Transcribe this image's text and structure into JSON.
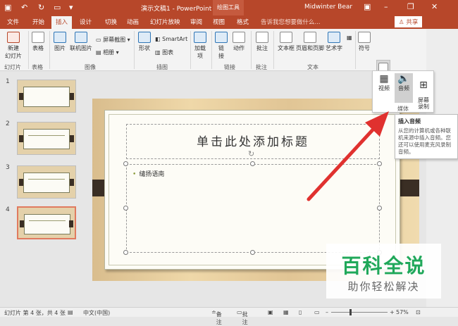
{
  "titlebar": {
    "document_title": "演示文稿1 - PowerPoint",
    "context_tab": "绘图工具",
    "user_name": "Midwinter Bear"
  },
  "tabs": [
    {
      "label": "文件"
    },
    {
      "label": "开始"
    },
    {
      "label": "插入"
    },
    {
      "label": "设计"
    },
    {
      "label": "切换"
    },
    {
      "label": "动画"
    },
    {
      "label": "幻灯片放映"
    },
    {
      "label": "审阅"
    },
    {
      "label": "视图"
    },
    {
      "label": "格式"
    }
  ],
  "tell_me_placeholder": "告诉我您想要做什么...",
  "share_label": "共享",
  "ribbon": {
    "new_slide": "新建\n幻灯片",
    "table": "表格",
    "picture": "图片",
    "online_picture": "联机图片",
    "screenshot": "屏幕截图",
    "album": "相册",
    "shapes": "形状",
    "smartart": "SmartArt",
    "chart": "图表",
    "addins": "加载\n项",
    "link": "链\n接",
    "action": "动作",
    "comment": "批注",
    "textbox": "文本框",
    "header_footer": "页眉和页脚",
    "wordart": "艺术字",
    "symbol": "符号",
    "media": "媒体",
    "groups": {
      "slides": "幻灯片",
      "tables": "表格",
      "images": "图像",
      "illustrations": "插图",
      "links": "链接",
      "comments": "批注",
      "text": "文本"
    }
  },
  "media_dropdown": {
    "video": "视频",
    "audio": "音频",
    "screen_recording": "屏幕\n录制",
    "group_label": "媒体"
  },
  "tooltip": {
    "title": "插入音频",
    "body": "从您的计算机或各种联机来源中插入音频。您还可以使用麦克风录制音频。"
  },
  "slides": [
    {
      "number": "1"
    },
    {
      "number": "2"
    },
    {
      "number": "3"
    },
    {
      "number": "4"
    }
  ],
  "slide_content": {
    "title": "单击此处添加标题",
    "bullet": "缱扬语南"
  },
  "watermark": {
    "title": "百科全说",
    "subtitle": "助你轻松解决"
  },
  "statusbar": {
    "slide_info": "幻灯片 第 4 张，共 4 张",
    "language": "中文(中国)",
    "notes": "备注",
    "comments": "批注",
    "zoom": "57%"
  },
  "colors": {
    "accent": "#b7472a",
    "arrow": "#e0312f",
    "watermark_green": "#20a85a"
  }
}
